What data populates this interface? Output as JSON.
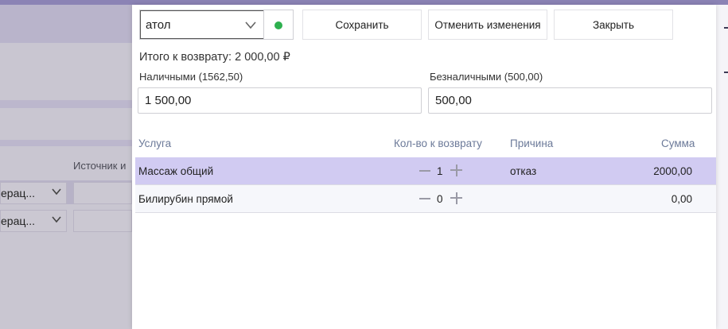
{
  "background": {
    "column_label": "Источник и",
    "rows": [
      {
        "select_value": "ерац..."
      },
      {
        "select_value": "ерац..."
      }
    ]
  },
  "register": {
    "value": "атол",
    "status_color": "#2eb04f"
  },
  "toolbar": {
    "save_label": "Сохранить",
    "revert_label": "Отменить изменения",
    "close_label": "Закрыть"
  },
  "refund": {
    "total_text": "Итого к возврату: 2 000,00 ₽",
    "cash_label": "Наличными (1562,50)",
    "cash_value": "1 500,00",
    "card_label": "Безналичными (500,00)",
    "card_value": "500,00"
  },
  "table": {
    "headers": {
      "service": "Услуга",
      "qty": "Кол-во к возврату",
      "reason": "Причина",
      "sum": "Сумма"
    },
    "rows": [
      {
        "service": "Массаж общий",
        "qty": "1",
        "reason": "отказ",
        "sum": "2000,00"
      },
      {
        "service": "Билирубин прямой",
        "qty": "0",
        "reason": "",
        "sum": "0,00"
      }
    ]
  },
  "colors": {
    "accent": "#8b83b5",
    "selected_row": "#d1cbf2",
    "header_text": "#6c7a99"
  }
}
